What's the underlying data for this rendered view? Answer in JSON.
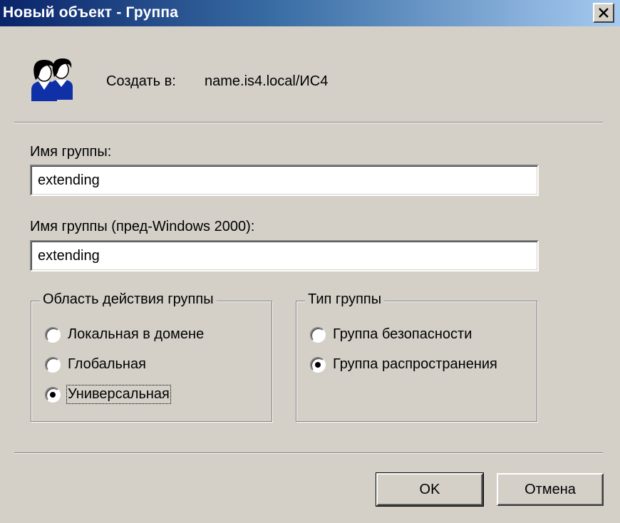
{
  "window": {
    "title": "Новый объект - Группа",
    "close_icon": "close-icon"
  },
  "header": {
    "icon": "group-users-icon",
    "create_in_label": "Создать в:",
    "create_in_path": "name.is4.local/ИС4"
  },
  "fields": {
    "group_name": {
      "label": "Имя группы:",
      "value": "extending"
    },
    "group_name_pre2000": {
      "label": "Имя группы (пред-Windows 2000):",
      "value": "extending"
    }
  },
  "scope": {
    "legend": "Область действия группы",
    "options": [
      {
        "label": "Локальная в домене",
        "selected": false
      },
      {
        "label": "Глобальная",
        "selected": false
      },
      {
        "label": "Универсальная",
        "selected": true
      }
    ]
  },
  "type": {
    "legend": "Тип группы",
    "options": [
      {
        "label": "Группа безопасности",
        "selected": false
      },
      {
        "label": "Группа распространения",
        "selected": true
      }
    ]
  },
  "buttons": {
    "ok": "OK",
    "cancel": "Отмена"
  },
  "colors": {
    "titlebar_start": "#0a246a",
    "titlebar_end": "#a6caf0",
    "dialog_bg": "#d4d0c8"
  }
}
